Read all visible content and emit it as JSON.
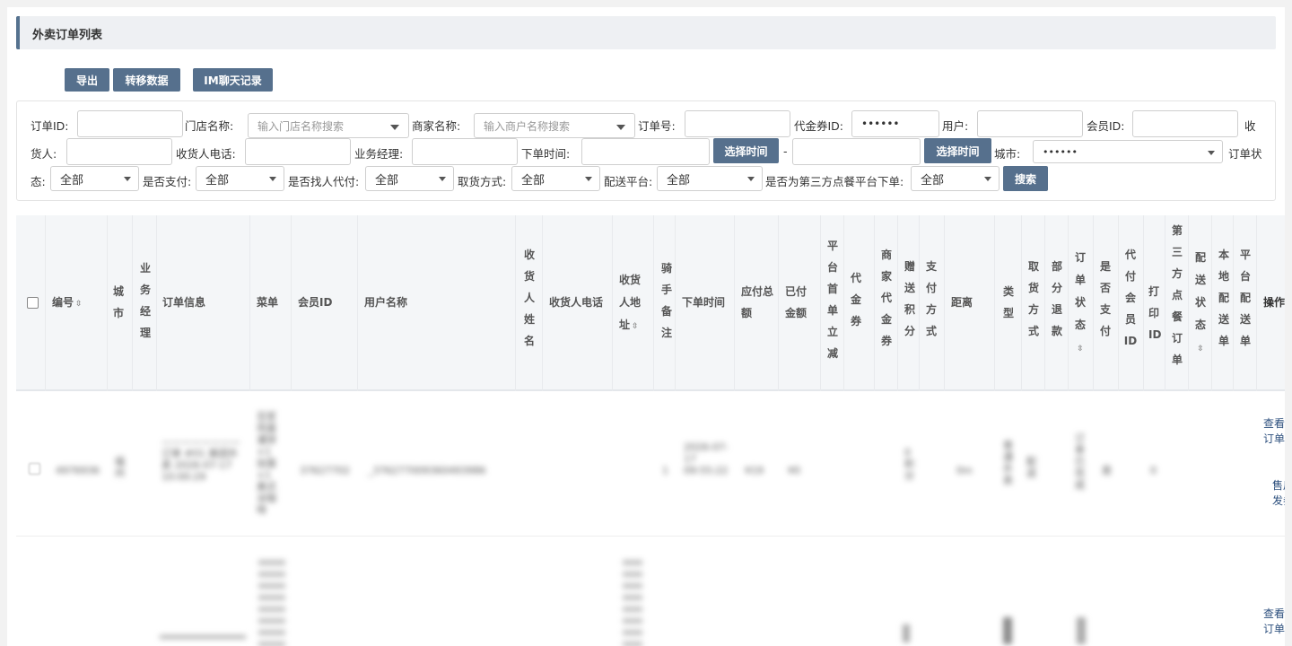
{
  "title": "外卖订单列表",
  "toolbar": {
    "export": "导出",
    "transfer": "转移数据",
    "im": "IM聊天记录"
  },
  "filters": {
    "order_id": "订单ID:",
    "store_name": "门店名称:",
    "store_placeholder": "输入门店名称搜索",
    "merchant_name": "商家名称:",
    "merchant_placeholder": "输入商户名称搜索",
    "order_no": "订单号:",
    "voucher_id": "代金券ID:",
    "voucher_value": "••••••",
    "user": "用户:",
    "member_id": "会员ID:",
    "receiver_part1": "收",
    "receiver_part2": "货人:",
    "receiver_phone": "收货人电话:",
    "biz_manager": "业务经理:",
    "order_time": "下单时间:",
    "choose_time": "选择时间",
    "dash": "-",
    "city": "城市:",
    "city_value": "••••••",
    "status_part1": "订单状",
    "status_part2": "态:",
    "is_paid": "是否支付:",
    "proxy": "是否找人代付:",
    "pickup": "取货方式:",
    "platform": "配送平台:",
    "third_party": "是否为第三方点餐平台下单:",
    "all": "全部",
    "search": "搜索"
  },
  "columns": {
    "id": "编号",
    "city": "城市",
    "manager": "业务经理",
    "info": "订单信息",
    "menu": "菜单",
    "member": "会员ID",
    "username": "用户名称",
    "receiver": "收货人姓名",
    "phone": "收货人电话",
    "addr1": "收货",
    "addr2": "人地",
    "addr3": "址",
    "rider": "骑手备注",
    "time": "下单时间",
    "payable1": "应付总",
    "payable2": "额",
    "paid1": "已付",
    "paid2": "金额",
    "first": "平台首单立减",
    "voucher": "代金券",
    "merchant_voucher": "商家代金券",
    "points": "赠送积分",
    "paymethod": "支付方式",
    "distance": "距离",
    "type": "类型",
    "pickup": "取货方式",
    "refund": "部分退款",
    "status1": "订单状",
    "status2": "态",
    "ispaid": "是否支付",
    "proxy": "代付会员ID",
    "print1": "打印",
    "print2": "ID",
    "third": "第三方点餐订单",
    "dstatus1": "配送状",
    "dstatus2": "态",
    "local": "本地配送单",
    "plat": "平台配送单",
    "ops": "操作"
  },
  "rows": [
    {
      "id": "4976936",
      "city": "福州",
      "info": "———————— 订单 #01 美团外卖 2026-07-17 10:00:29",
      "menu": "豆浆 鸡蛋灌饼 ×1 加蛋×1 美式 冰咖啡",
      "member": "37627702",
      "username": "_376277009360493986",
      "rider": "1",
      "time": "2026-07-17 09:55:22",
      "payable": "¥19",
      "paid": "¥0",
      "points": "0 积分",
      "distance": "0m",
      "type": "普通外卖",
      "pickup": "配送",
      "status": "订单已完成",
      "ispaid": "是",
      "print": "0",
      "op_view": "查看订单",
      "op_after": "售后发券"
    },
    {
      "op_view": "查看订单"
    }
  ]
}
